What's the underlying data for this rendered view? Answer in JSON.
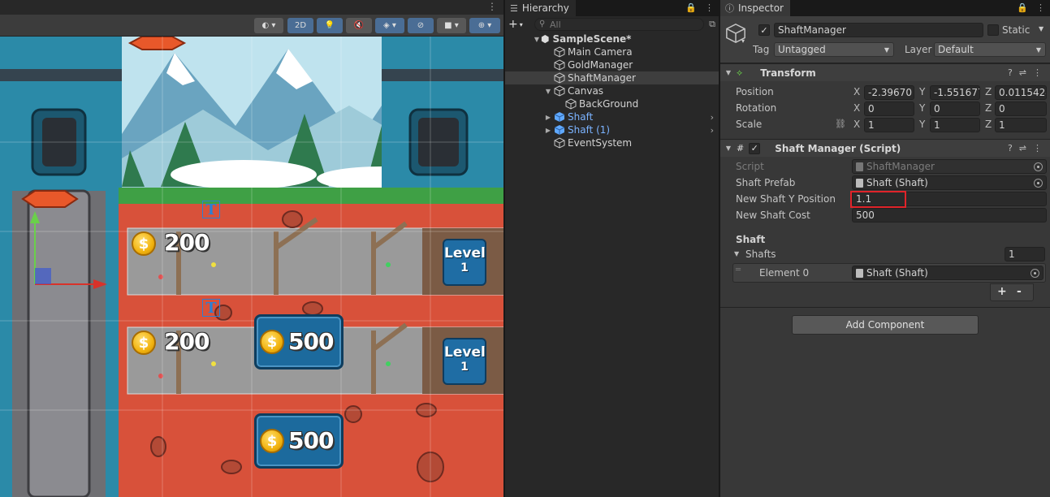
{
  "scene_toolbar": {
    "mode_2d": "2D"
  },
  "game": {
    "shafts": [
      {
        "gold": "200",
        "level_label": "Level",
        "level_value": "1"
      },
      {
        "gold": "200",
        "level_label": "Level",
        "level_value": "1"
      }
    ],
    "buy_buttons": [
      {
        "cost": "500"
      },
      {
        "cost": "500"
      }
    ],
    "ui_text_glyph": "T"
  },
  "hierarchy": {
    "tab_label": "Hierarchy",
    "search_placeholder": "All",
    "scene_name": "SampleScene*",
    "items": [
      {
        "label": "Main Camera"
      },
      {
        "label": "GoldManager"
      },
      {
        "label": "ShaftManager"
      },
      {
        "label": "Canvas"
      },
      {
        "label": "BackGround"
      },
      {
        "label": "Shaft"
      },
      {
        "label": "Shaft (1)"
      },
      {
        "label": "EventSystem"
      }
    ]
  },
  "inspector": {
    "tab_label": "Inspector",
    "object_name": "ShaftManager",
    "static_label": "Static",
    "tag_label": "Tag",
    "tag_value": "Untagged",
    "layer_label": "Layer",
    "layer_value": "Default",
    "transform": {
      "title": "Transform",
      "position_label": "Position",
      "rotation_label": "Rotation",
      "scale_label": "Scale",
      "axis_x": "X",
      "axis_y": "Y",
      "axis_z": "Z",
      "position": {
        "x": "-2.39670",
        "y": "-1.551677",
        "z": "0.0115424"
      },
      "rotation": {
        "x": "0",
        "y": "0",
        "z": "0"
      },
      "scale": {
        "x": "1",
        "y": "1",
        "z": "1"
      }
    },
    "shaft_manager": {
      "title": "Shaft Manager (Script)",
      "script_label": "Script",
      "script_value": "ShaftManager",
      "prefab_label": "Shaft Prefab",
      "prefab_value": "Shaft (Shaft)",
      "new_y_label": "New Shaft Y Position",
      "new_y_value": "1.1",
      "cost_label": "New Shaft Cost",
      "cost_value": "500",
      "section_label": "Shaft",
      "list_label": "Shafts",
      "list_count": "1",
      "element_label": "Element 0",
      "element_value": "Shaft (Shaft)",
      "plus": "+",
      "minus": "-"
    },
    "add_component_label": "Add Component"
  },
  "colors": {
    "accent_blue": "#4a6d95",
    "highlight_red": "#e0242a",
    "prefab_blue": "#7bb3ff"
  }
}
